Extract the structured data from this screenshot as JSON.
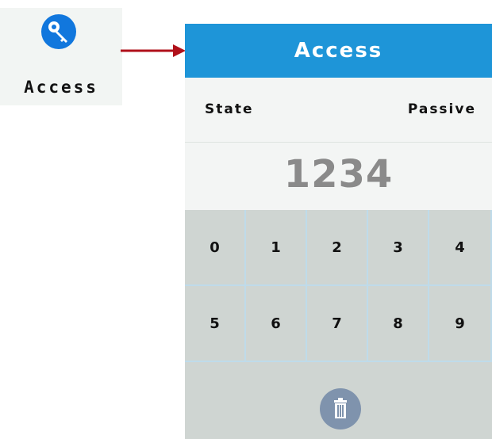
{
  "app_icon": {
    "label": "Access",
    "icon": "key-icon",
    "color": "#1177dd"
  },
  "panel": {
    "title": "Access",
    "state_label": "State",
    "state_value": "Passive",
    "code": "1234",
    "keypad": {
      "row1": [
        "0",
        "1",
        "2",
        "3",
        "4"
      ],
      "row2": [
        "5",
        "6",
        "7",
        "8",
        "9"
      ]
    },
    "delete_icon": "trash-icon"
  },
  "colors": {
    "title_bar": "#1e95d8",
    "arrow": "#b0101a",
    "keypad_bg": "#cfd5d2",
    "code_text": "#8a8a8a"
  }
}
